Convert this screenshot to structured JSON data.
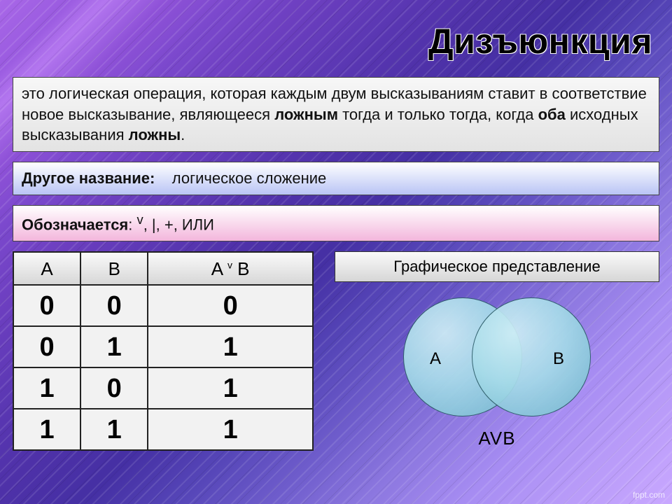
{
  "title": "Дизъюнкция",
  "definition": {
    "pre": "это логическая операция, которая каждым двум высказываниям ставит в соответствие новое высказывание, являющееся ",
    "bold1": "ложным",
    "mid": " тогда и только тогда, когда ",
    "bold2": "оба",
    "mid2": " исходных высказывания ",
    "bold3": "ложны",
    "post": "."
  },
  "altname": {
    "label": "Другое название:",
    "value": "логическое сложение"
  },
  "notation": {
    "label": "Обозначается",
    "sup": "v",
    "value": ", |, +, ИЛИ"
  },
  "truth_table": {
    "headers": {
      "a": "A",
      "b": "B",
      "ab_pre": "A ",
      "ab_sup": "v",
      "ab_post": " B"
    },
    "rows": [
      {
        "a": "0",
        "b": "0",
        "r": "0"
      },
      {
        "a": "0",
        "b": "1",
        "r": "1"
      },
      {
        "a": "1",
        "b": "0",
        "r": "1"
      },
      {
        "a": "1",
        "b": "1",
        "r": "1"
      }
    ]
  },
  "graphic": {
    "heading": "Графическое представление",
    "labelA": "A",
    "labelB": "B",
    "caption": "AVB"
  },
  "watermark": "fppt.com"
}
